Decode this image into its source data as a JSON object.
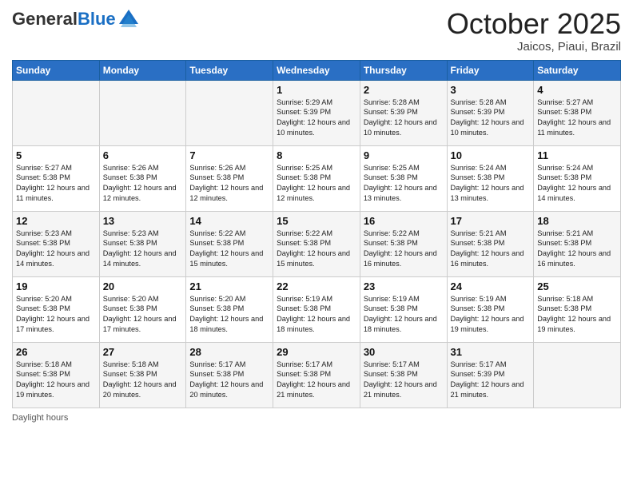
{
  "header": {
    "logo_general": "General",
    "logo_blue": "Blue",
    "month": "October 2025",
    "location": "Jaicos, Piaui, Brazil"
  },
  "days_of_week": [
    "Sunday",
    "Monday",
    "Tuesday",
    "Wednesday",
    "Thursday",
    "Friday",
    "Saturday"
  ],
  "weeks": [
    [
      {
        "num": "",
        "info": ""
      },
      {
        "num": "",
        "info": ""
      },
      {
        "num": "",
        "info": ""
      },
      {
        "num": "1",
        "info": "Sunrise: 5:29 AM\nSunset: 5:39 PM\nDaylight: 12 hours\nand 10 minutes."
      },
      {
        "num": "2",
        "info": "Sunrise: 5:28 AM\nSunset: 5:39 PM\nDaylight: 12 hours\nand 10 minutes."
      },
      {
        "num": "3",
        "info": "Sunrise: 5:28 AM\nSunset: 5:39 PM\nDaylight: 12 hours\nand 10 minutes."
      },
      {
        "num": "4",
        "info": "Sunrise: 5:27 AM\nSunset: 5:38 PM\nDaylight: 12 hours\nand 11 minutes."
      }
    ],
    [
      {
        "num": "5",
        "info": "Sunrise: 5:27 AM\nSunset: 5:38 PM\nDaylight: 12 hours\nand 11 minutes."
      },
      {
        "num": "6",
        "info": "Sunrise: 5:26 AM\nSunset: 5:38 PM\nDaylight: 12 hours\nand 12 minutes."
      },
      {
        "num": "7",
        "info": "Sunrise: 5:26 AM\nSunset: 5:38 PM\nDaylight: 12 hours\nand 12 minutes."
      },
      {
        "num": "8",
        "info": "Sunrise: 5:25 AM\nSunset: 5:38 PM\nDaylight: 12 hours\nand 12 minutes."
      },
      {
        "num": "9",
        "info": "Sunrise: 5:25 AM\nSunset: 5:38 PM\nDaylight: 12 hours\nand 13 minutes."
      },
      {
        "num": "10",
        "info": "Sunrise: 5:24 AM\nSunset: 5:38 PM\nDaylight: 12 hours\nand 13 minutes."
      },
      {
        "num": "11",
        "info": "Sunrise: 5:24 AM\nSunset: 5:38 PM\nDaylight: 12 hours\nand 14 minutes."
      }
    ],
    [
      {
        "num": "12",
        "info": "Sunrise: 5:23 AM\nSunset: 5:38 PM\nDaylight: 12 hours\nand 14 minutes."
      },
      {
        "num": "13",
        "info": "Sunrise: 5:23 AM\nSunset: 5:38 PM\nDaylight: 12 hours\nand 14 minutes."
      },
      {
        "num": "14",
        "info": "Sunrise: 5:22 AM\nSunset: 5:38 PM\nDaylight: 12 hours\nand 15 minutes."
      },
      {
        "num": "15",
        "info": "Sunrise: 5:22 AM\nSunset: 5:38 PM\nDaylight: 12 hours\nand 15 minutes."
      },
      {
        "num": "16",
        "info": "Sunrise: 5:22 AM\nSunset: 5:38 PM\nDaylight: 12 hours\nand 16 minutes."
      },
      {
        "num": "17",
        "info": "Sunrise: 5:21 AM\nSunset: 5:38 PM\nDaylight: 12 hours\nand 16 minutes."
      },
      {
        "num": "18",
        "info": "Sunrise: 5:21 AM\nSunset: 5:38 PM\nDaylight: 12 hours\nand 16 minutes."
      }
    ],
    [
      {
        "num": "19",
        "info": "Sunrise: 5:20 AM\nSunset: 5:38 PM\nDaylight: 12 hours\nand 17 minutes."
      },
      {
        "num": "20",
        "info": "Sunrise: 5:20 AM\nSunset: 5:38 PM\nDaylight: 12 hours\nand 17 minutes."
      },
      {
        "num": "21",
        "info": "Sunrise: 5:20 AM\nSunset: 5:38 PM\nDaylight: 12 hours\nand 18 minutes."
      },
      {
        "num": "22",
        "info": "Sunrise: 5:19 AM\nSunset: 5:38 PM\nDaylight: 12 hours\nand 18 minutes."
      },
      {
        "num": "23",
        "info": "Sunrise: 5:19 AM\nSunset: 5:38 PM\nDaylight: 12 hours\nand 18 minutes."
      },
      {
        "num": "24",
        "info": "Sunrise: 5:19 AM\nSunset: 5:38 PM\nDaylight: 12 hours\nand 19 minutes."
      },
      {
        "num": "25",
        "info": "Sunrise: 5:18 AM\nSunset: 5:38 PM\nDaylight: 12 hours\nand 19 minutes."
      }
    ],
    [
      {
        "num": "26",
        "info": "Sunrise: 5:18 AM\nSunset: 5:38 PM\nDaylight: 12 hours\nand 19 minutes."
      },
      {
        "num": "27",
        "info": "Sunrise: 5:18 AM\nSunset: 5:38 PM\nDaylight: 12 hours\nand 20 minutes."
      },
      {
        "num": "28",
        "info": "Sunrise: 5:17 AM\nSunset: 5:38 PM\nDaylight: 12 hours\nand 20 minutes."
      },
      {
        "num": "29",
        "info": "Sunrise: 5:17 AM\nSunset: 5:38 PM\nDaylight: 12 hours\nand 21 minutes."
      },
      {
        "num": "30",
        "info": "Sunrise: 5:17 AM\nSunset: 5:38 PM\nDaylight: 12 hours\nand 21 minutes."
      },
      {
        "num": "31",
        "info": "Sunrise: 5:17 AM\nSunset: 5:39 PM\nDaylight: 12 hours\nand 21 minutes."
      },
      {
        "num": "",
        "info": ""
      }
    ]
  ],
  "footer": {
    "daylight_label": "Daylight hours"
  }
}
